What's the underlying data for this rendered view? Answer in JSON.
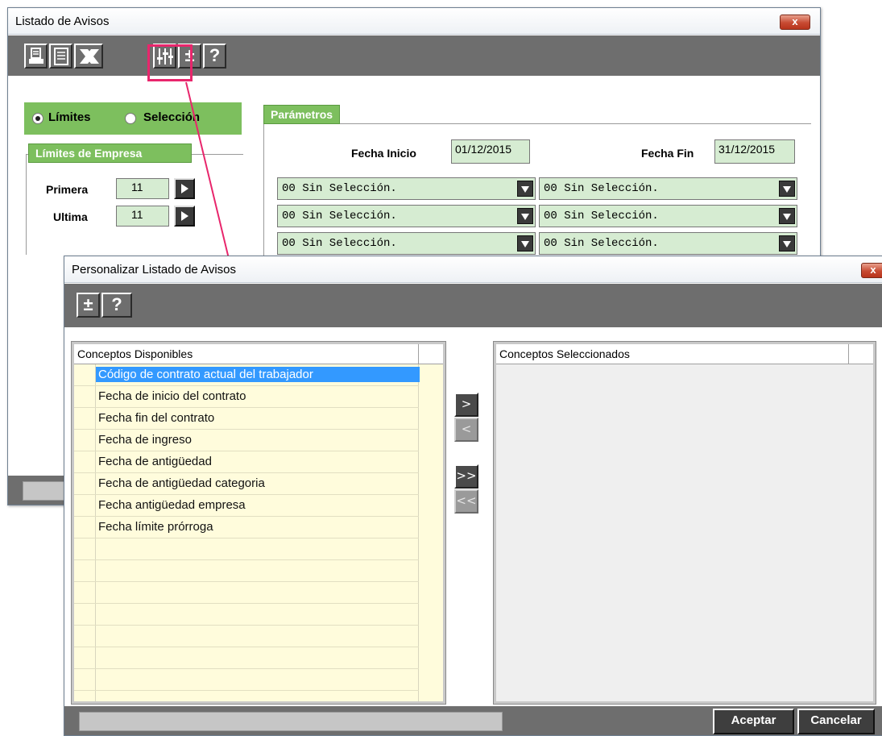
{
  "back_window": {
    "title": "Listado de Avisos",
    "close_label": "x",
    "toolbar": {
      "print_icon": "printer-icon",
      "preview_icon": "document-icon",
      "excel_icon": "excel-icon",
      "customize_icon": "sliders-icon",
      "plusminus_label": "±",
      "help_label": "?"
    },
    "mode": {
      "limits_label": "Límites",
      "selection_label": "Selección",
      "selected": "limits"
    },
    "company_limits": {
      "title": "Límites de Empresa",
      "first_label": "Primera",
      "first_value": "11",
      "last_label": "Ultima",
      "last_value": "11"
    },
    "parameters": {
      "title": "Parámetros",
      "start_label": "Fecha Inicio",
      "start_value": "01/12/2015",
      "end_label": "Fecha Fin",
      "end_value": "31/12/2015",
      "selectors": [
        "00 Sin Selección.",
        "00 Sin Selección.",
        "00 Sin Selección.",
        "00 Sin Selección.",
        "00 Sin Selección.",
        "00 Sin Selección."
      ]
    }
  },
  "front_window": {
    "title": "Personalizar Listado de Avisos",
    "close_label": "x",
    "toolbar": {
      "plusminus_label": "±",
      "help_label": "?"
    },
    "available": {
      "header": "Conceptos Disponibles",
      "items": [
        "Código de contrato actual del trabajador",
        "Fecha de inicio del contrato",
        "Fecha fin del contrato",
        "Fecha de ingreso",
        "Fecha de antigüedad",
        "Fecha de antigüedad categoria",
        "Fecha antigüedad empresa",
        "Fecha límite prórroga"
      ],
      "selected_index": 0
    },
    "selected": {
      "header": "Conceptos Seleccionados",
      "items": []
    },
    "move_buttons": {
      "add_one": ">",
      "remove_one": "<",
      "add_all": ">>",
      "remove_all": "<<"
    },
    "footer": {
      "accept_label": "Aceptar",
      "cancel_label": "Cancelar"
    }
  },
  "colors": {
    "accent_green": "#7dbf5e",
    "field_green": "#d6ecd2",
    "annotation_pink": "#e8266c",
    "list_bg": "#fffcdc",
    "selection_blue": "#3399ff"
  }
}
